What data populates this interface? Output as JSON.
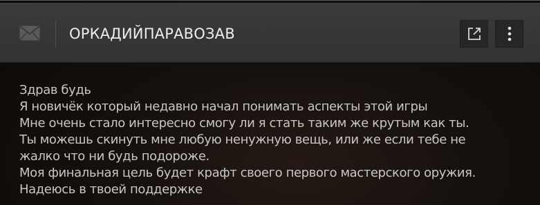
{
  "message": {
    "sender": "ОРКАДИЙПАРАВОЗАВ",
    "icons": {
      "mail": "mail-icon",
      "open_external": "external-link-icon",
      "more": "more-vertical-icon"
    },
    "lines": [
      "Здрав будь",
      "Я новичёк который недавно начал понимать аспекты этой игры",
      "Мне очень стало интересно смогу ли я стать таким же крутым как ты.",
      "Ты можешь скинуть мне любую ненужную вещь, или же если тебе не",
      "жалко что ни будь подороже.",
      "Моя финальная цель будет крафт своего первого мастерского оружия.",
      "Надеюсь в твоей поддержке"
    ]
  },
  "colors": {
    "header_bg": "#363636",
    "button_bg": "#262626",
    "text": "#c7c7c7",
    "title": "#eeeeee"
  }
}
